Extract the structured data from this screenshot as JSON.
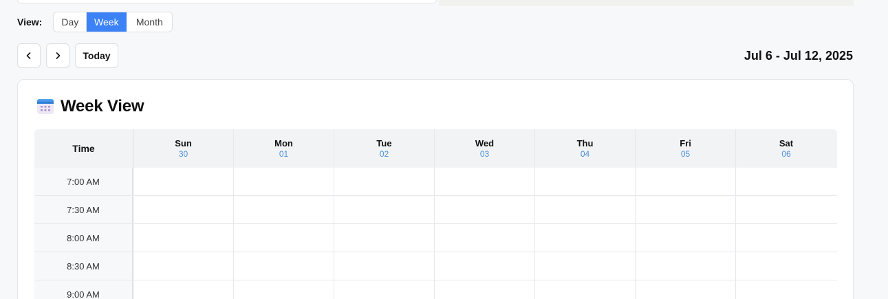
{
  "view": {
    "label": "View:",
    "options": [
      "Day",
      "Week",
      "Month"
    ],
    "selected": "Week"
  },
  "nav": {
    "today_label": "Today",
    "date_range": "Jul 6 - Jul 12, 2025"
  },
  "calendar": {
    "title": "Week View",
    "time_header": "Time",
    "days": [
      {
        "dow": "Sun",
        "date": "30"
      },
      {
        "dow": "Mon",
        "date": "01"
      },
      {
        "dow": "Tue",
        "date": "02"
      },
      {
        "dow": "Wed",
        "date": "03"
      },
      {
        "dow": "Thu",
        "date": "04"
      },
      {
        "dow": "Fri",
        "date": "05"
      },
      {
        "dow": "Sat",
        "date": "06"
      }
    ],
    "times": [
      "7:00 AM",
      "7:30 AM",
      "8:00 AM",
      "8:30 AM",
      "9:00 AM"
    ]
  },
  "colors": {
    "accent": "#3b82f6",
    "date_blue": "#4a90d9"
  }
}
